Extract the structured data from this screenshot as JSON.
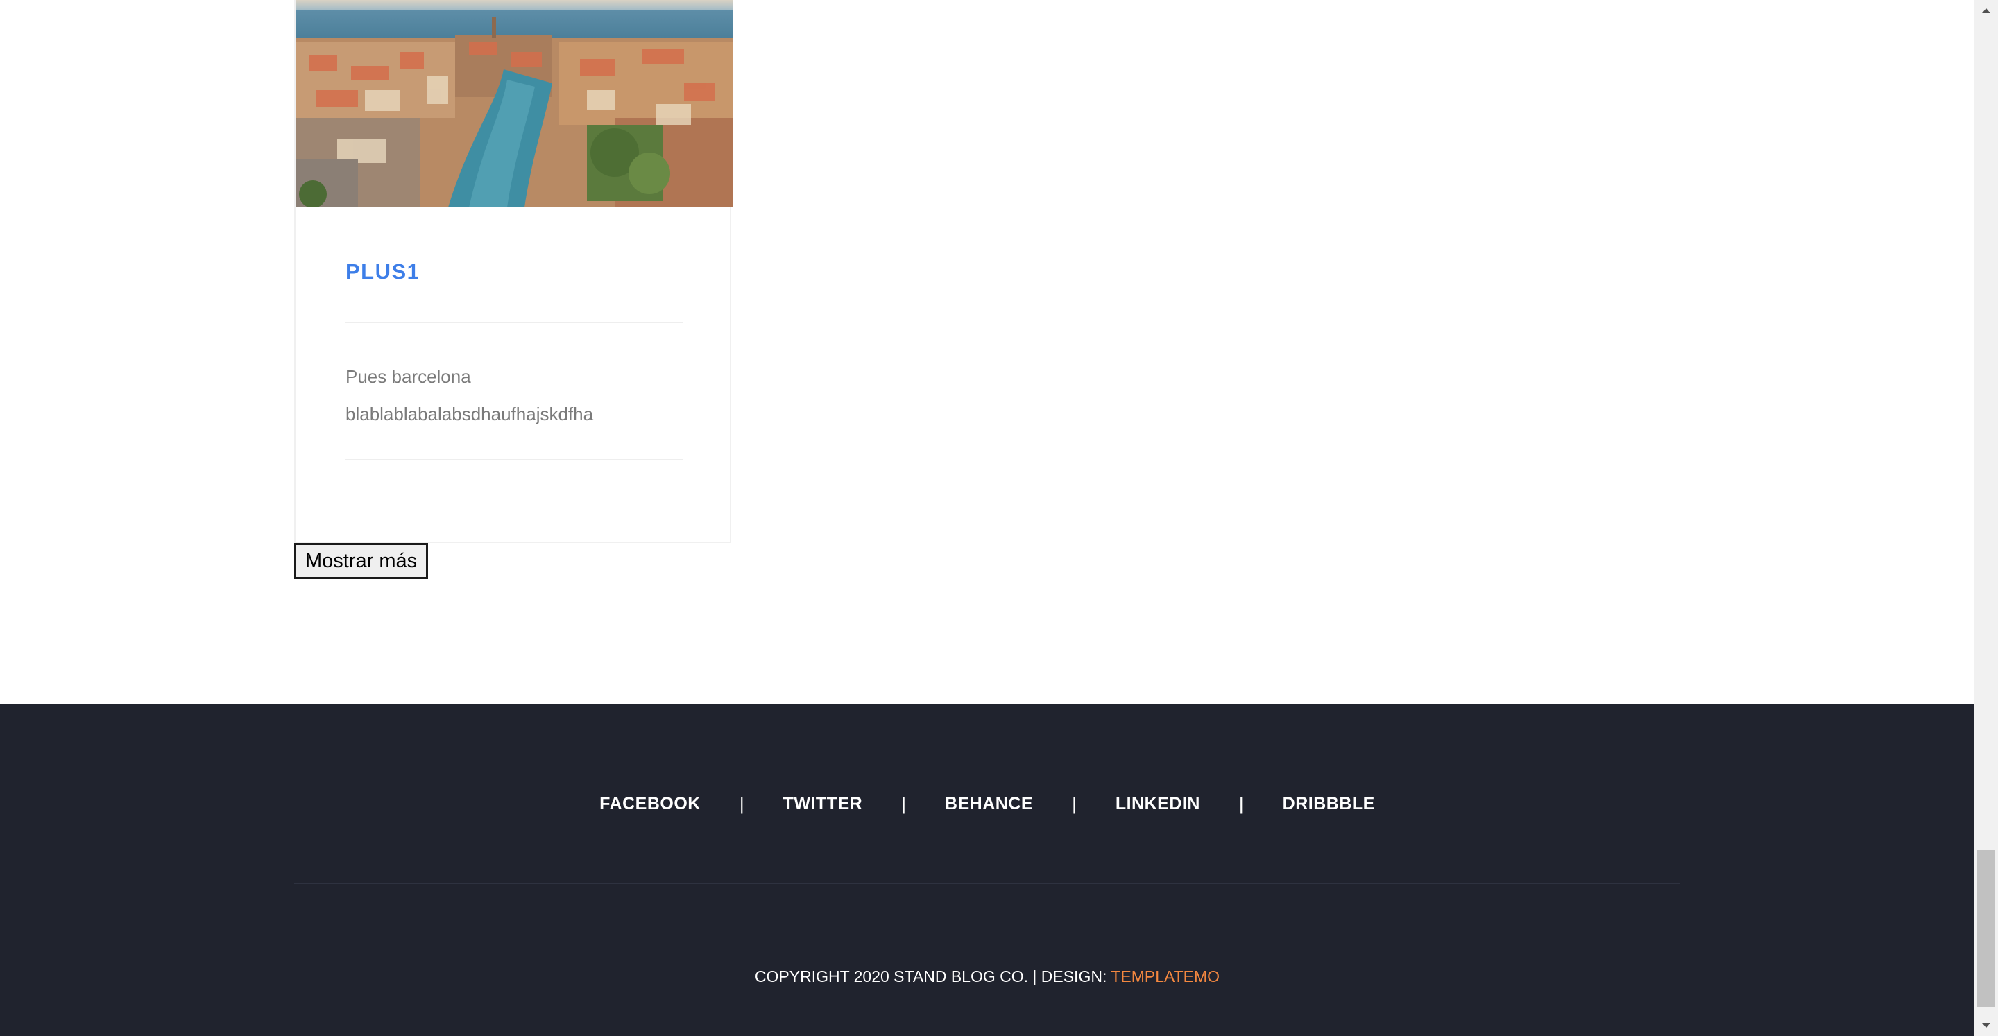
{
  "card": {
    "image_alt": "Aerial view of a coastal town with a canal",
    "title": "PLUS1",
    "text_line1": "Pues barcelona",
    "text_line2": "blablablabalabsdhaufhajskdfha"
  },
  "more_button": {
    "label": "Mostrar más"
  },
  "footer": {
    "social": [
      "FACEBOOK",
      "TWITTER",
      "BEHANCE",
      "LINKEDIN",
      "DRIBBBLE"
    ],
    "separator": "|",
    "copyright": "COPYRIGHT 2020 STAND BLOG CO. | DESIGN: ",
    "designer": "TEMPLATEMO"
  },
  "colors": {
    "accent_title": "#3d7ee8",
    "accent_link": "#f48840",
    "footer_bg": "#20232e"
  }
}
